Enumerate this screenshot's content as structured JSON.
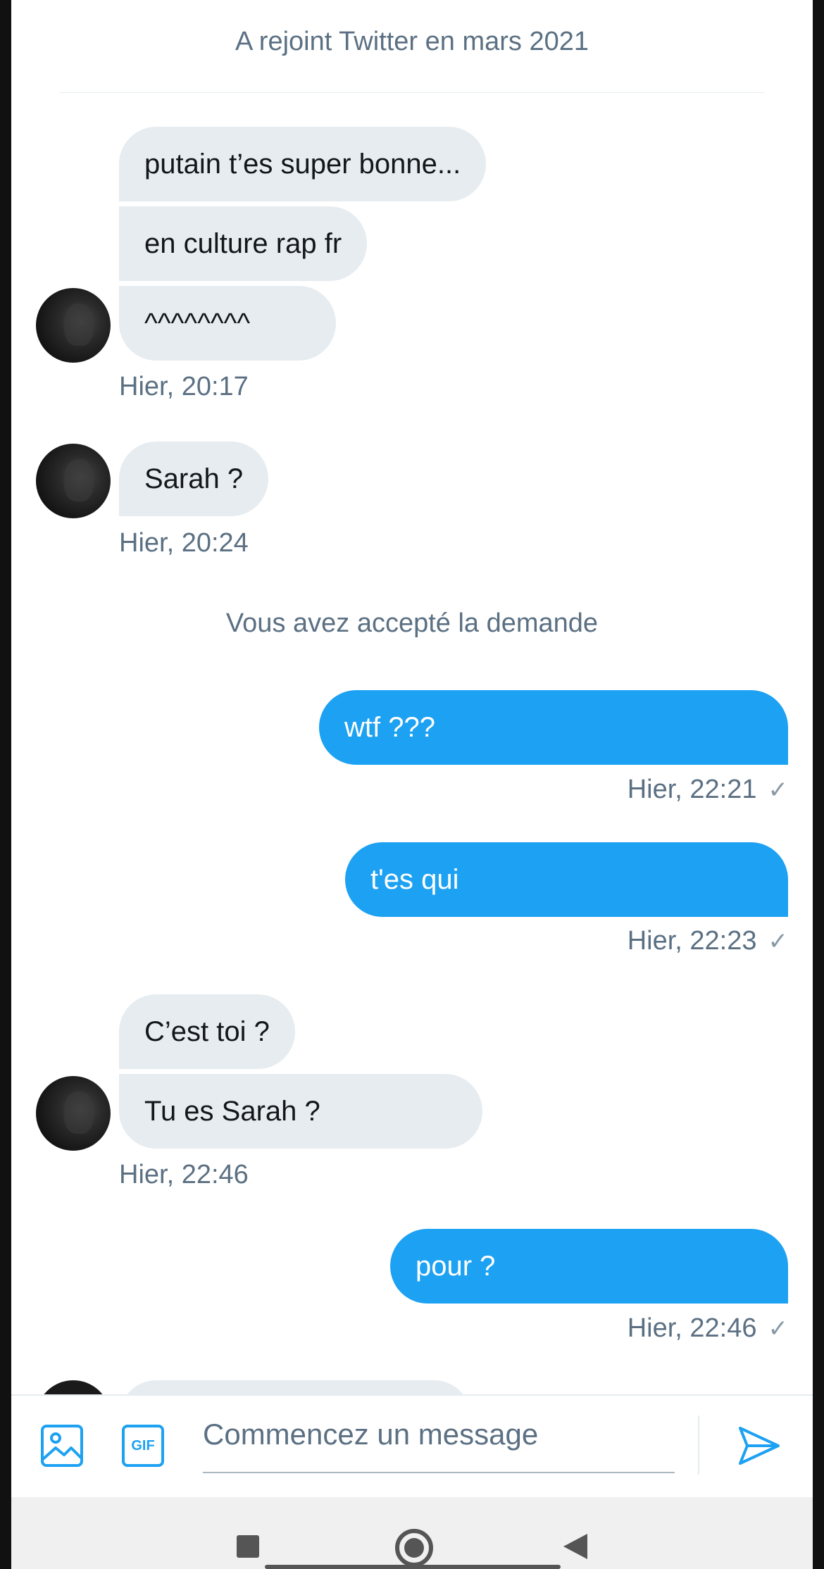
{
  "profile": {
    "joined": "A rejoint Twitter en mars 2021"
  },
  "messages": {
    "g1": {
      "b1": "putain t’es super bonne...",
      "b2": "en culture rap fr",
      "b3": "^^^^^^^^",
      "time": "Hier, 20:17"
    },
    "g2": {
      "b1": "Sarah ?",
      "time": "Hier, 20:24"
    },
    "system": "Vous avez accepté la demande",
    "o1": {
      "text": "wtf ???",
      "time": "Hier, 22:21"
    },
    "o2": {
      "text": "t'es qui",
      "time": "Hier, 22:23"
    },
    "g3": {
      "b1": "C’est toi ?",
      "b2": "Tu es Sarah ?",
      "time": "Hier, 22:46"
    },
    "o3": {
      "text": "pour ?",
      "time": "Hier, 22:46"
    },
    "check": "✓"
  },
  "composer": {
    "placeholder": "Commencez un message",
    "gif_label": "GIF",
    "image_icon": "image-icon",
    "send_icon": "send-icon"
  },
  "colors": {
    "accent": "#1da1f2",
    "incoming_bubble": "#e6ecf0",
    "secondary_text": "#5b7083"
  }
}
